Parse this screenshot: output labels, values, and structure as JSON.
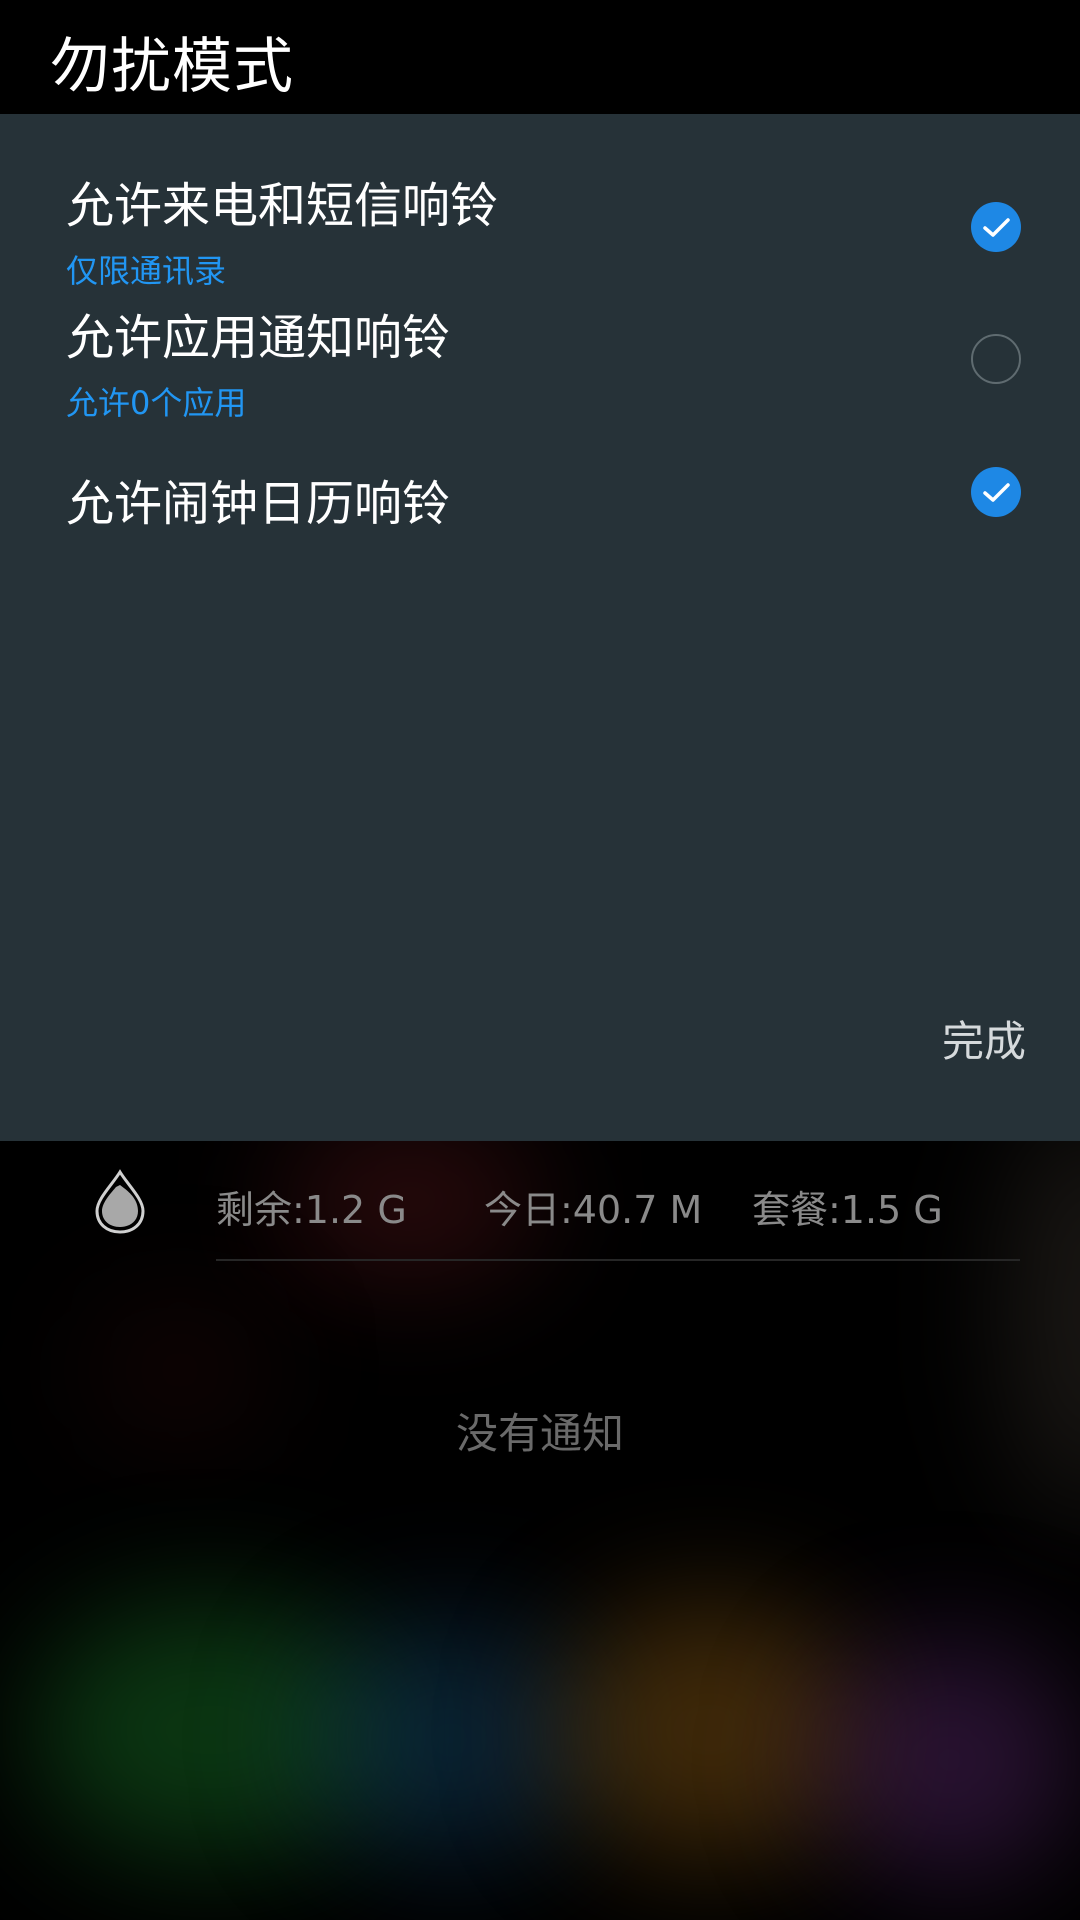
{
  "header": {
    "title": "勿扰模式"
  },
  "options": [
    {
      "title": "允许来电和短信响铃",
      "subtitle": "仅限通讯录",
      "checked": true
    },
    {
      "title": "允许应用通知响铃",
      "subtitle": "允许0个应用",
      "checked": false
    },
    {
      "title": "允许闹钟日历响铃",
      "checked": true
    }
  ],
  "actions": {
    "done_label": "完成"
  },
  "data_usage": {
    "icon": "water-drop-icon",
    "remaining": "剩余:1.2 G",
    "today": "今日:40.7 M",
    "plan": "套餐:1.5 G"
  },
  "notifications": {
    "empty_text": "没有通知"
  },
  "colors": {
    "panel_bg": "#263238",
    "accent": "#1e88e5",
    "subtitle": "#2196f3"
  }
}
